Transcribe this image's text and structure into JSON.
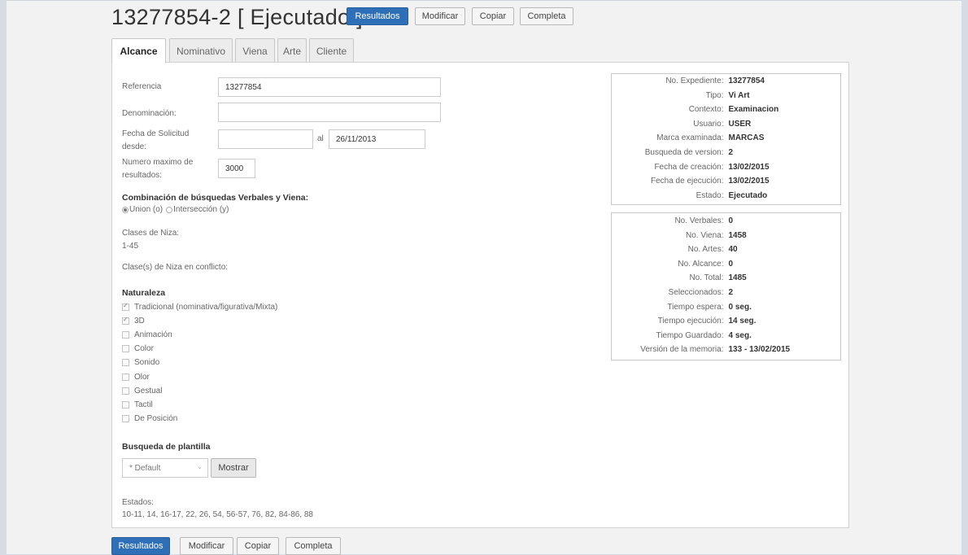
{
  "header": {
    "title": "13277854-2 [ Ejecutado ]",
    "buttons": [
      "Resultados",
      "Modificar",
      "Copiar",
      "Completa"
    ]
  },
  "tabs": [
    "Alcance",
    "Nominativo",
    "Viena",
    "Arte",
    "Cliente"
  ],
  "form": {
    "referencia_label": "Referencia",
    "referencia_value": "13277854",
    "denominacion_label": "Denominación:",
    "denominacion_value": "",
    "fecha_label_1": "Fecha de Solicitud",
    "fecha_label_2": "desde:",
    "fecha_desde_value": "",
    "fecha_al_label": "al",
    "fecha_hasta_value": "26/11/2013",
    "max_label_1": "Numero maximo de",
    "max_label_2": "resultados:",
    "max_value": "3000",
    "combinacion_heading": "Combinación de búsquedas Verbales y Viena:",
    "union_label": "Union (o)",
    "interseccion_label": "Intersección (y)",
    "clases_label": "Clases de Niza:",
    "clases_value": "1-45",
    "conflicto_label": "Clase(s) de Niza en conflicto:",
    "naturaleza_heading": "Naturaleza",
    "naturaleza": [
      {
        "label": "Tradicional (nominativa/figurativa/Mixta)",
        "checked": true
      },
      {
        "label": "3D",
        "checked": true
      },
      {
        "label": "Animación",
        "checked": false
      },
      {
        "label": "Color",
        "checked": false
      },
      {
        "label": "Sonido",
        "checked": false
      },
      {
        "label": "Olor",
        "checked": false
      },
      {
        "label": "Gestual",
        "checked": false
      },
      {
        "label": "Tactil",
        "checked": false
      },
      {
        "label": "De Posición",
        "checked": false
      }
    ],
    "plantilla_heading": "Busqueda de plantilla",
    "plantilla_selected": "* Default",
    "mostrar_label": "Mostrar",
    "estados_label": "Estados:",
    "estados_value": "10-11, 14, 16-17, 22, 26, 54, 56-57, 76, 82, 84-86, 88"
  },
  "info": [
    {
      "key": "No. Expediente:",
      "value": "13277854"
    },
    {
      "key": "Tipo:",
      "value": "Vi Art"
    },
    {
      "key": "Contexto:",
      "value": "Examinacion"
    },
    {
      "key": "Usuario:",
      "value": "USER"
    },
    {
      "key": "Marca examinada:",
      "value": "MARCAS"
    },
    {
      "key": "Busqueda de version:",
      "value": "2"
    },
    {
      "key": "Fecha de creación:",
      "value": "13/02/2015"
    },
    {
      "key": "Fecha de ejecución:",
      "value": "13/02/2015"
    },
    {
      "key": "Estado:",
      "value": "Ejecutado"
    }
  ],
  "stats": [
    {
      "key": "No. Verbales:",
      "value": "0"
    },
    {
      "key": "No. Viena:",
      "value": "1458"
    },
    {
      "key": "No. Artes:",
      "value": "40"
    },
    {
      "key": "No. Alcance:",
      "value": "0"
    },
    {
      "key": "No. Total:",
      "value": "1485"
    },
    {
      "key": "Seleccionados:",
      "value": "2"
    },
    {
      "key": "Tiempo espera:",
      "value": "0 seg."
    },
    {
      "key": "Tiempo ejecución:",
      "value": "14 seg."
    },
    {
      "key": "Tiempo Guardado:",
      "value": "4 seg."
    },
    {
      "key": "Versión de la memoria:",
      "value": "133 - 13/02/2015"
    }
  ],
  "footer": {
    "buttons": [
      "Resultados",
      "Modificar",
      "Copiar",
      "Completa"
    ]
  },
  "colors": {
    "primary": "#2f6fb8",
    "background": "#d6dbe4"
  },
  "icons": {
    "select_chevron": "chevron-down-icon",
    "checkbox_check": "check-icon"
  }
}
